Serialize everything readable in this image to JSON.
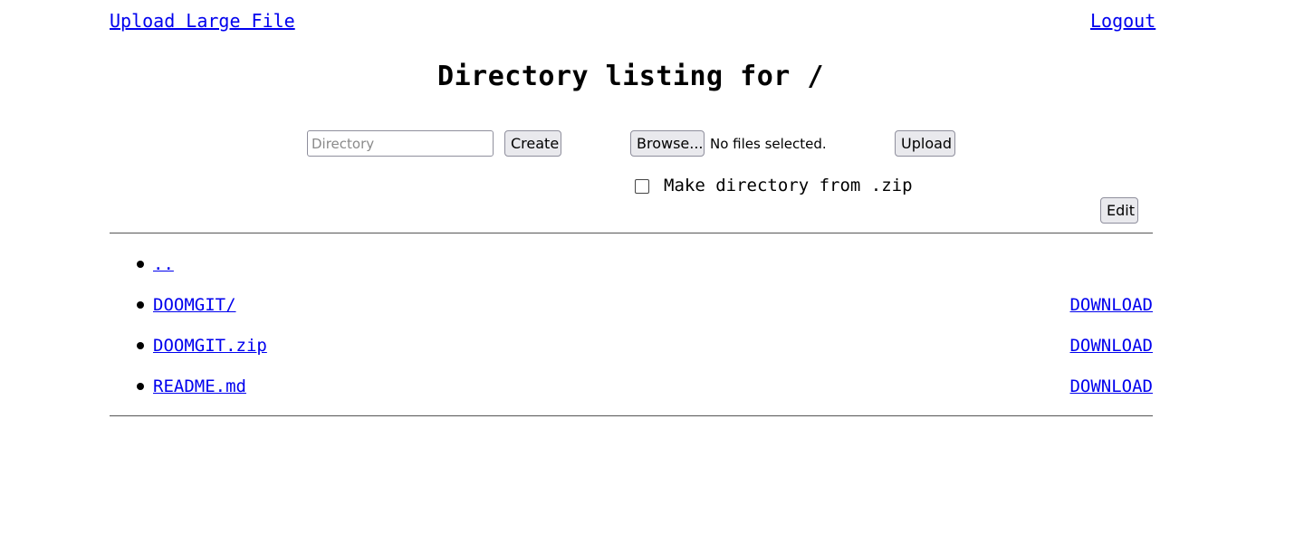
{
  "header": {
    "upload_large_label": "Upload Large File",
    "logout_label": "Logout"
  },
  "title": "Directory listing for /",
  "controls": {
    "directory_placeholder": "Directory",
    "create_label": "Create",
    "browse_label": "Browse...",
    "no_files_text": "No files selected.",
    "upload_label": "Upload",
    "zip_option_label": "Make directory from .zip",
    "zip_option_checked": false,
    "edit_label": "Edit"
  },
  "entries": [
    {
      "name": "..",
      "download": ""
    },
    {
      "name": "DOOMGIT/",
      "download": "DOWNLOAD"
    },
    {
      "name": "DOOMGIT.zip",
      "download": "DOWNLOAD"
    },
    {
      "name": "README.md",
      "download": "DOWNLOAD"
    }
  ],
  "colors": {
    "link": "#0000ee",
    "button_bg": "#e9e9ed",
    "button_border": "#8f8f9d"
  }
}
